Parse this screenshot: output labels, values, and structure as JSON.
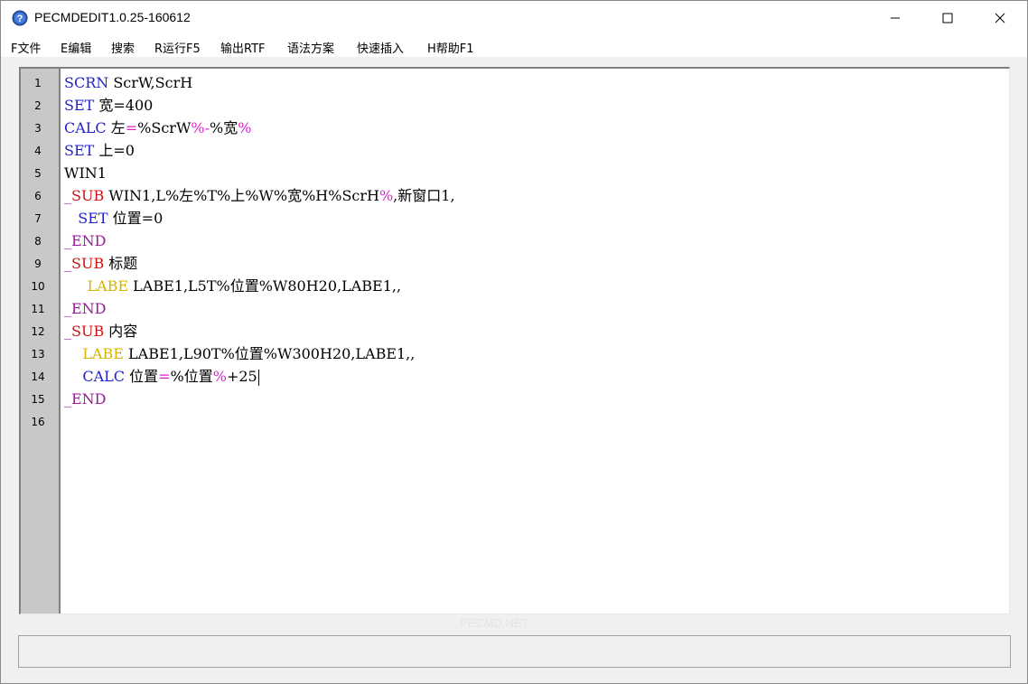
{
  "window": {
    "title": "PECMDEDIT1.0.25-160612",
    "icon": "help-question-icon"
  },
  "menu": [
    {
      "label": "F文件"
    },
    {
      "label": "E编辑"
    },
    {
      "label": "搜索"
    },
    {
      "label": "R运行F5"
    },
    {
      "label": "输出RTF"
    },
    {
      "label": "语法方案"
    },
    {
      "label": "快速插入"
    },
    {
      "label": "H帮助F1"
    }
  ],
  "line_numbers": [
    "1",
    "2",
    "3",
    "4",
    "5",
    "6",
    "7",
    "8",
    "9",
    "10",
    "11",
    "12",
    "13",
    "14",
    "15",
    "16"
  ],
  "code_tokens": {
    "l1": [
      "SCRN",
      " ScrW,ScrH"
    ],
    "l2": [
      "SET",
      " 宽=400"
    ],
    "l3": [
      "CALC",
      " 左",
      "=",
      "%ScrW",
      "%-",
      "%宽",
      "%"
    ],
    "l4": [
      "SET",
      " 上=0"
    ],
    "l5": [
      "WIN1"
    ],
    "l6": [
      "_",
      "SUB",
      " WIN1,L%左%T%上%W%宽%H%ScrH",
      "%",
      ",新窗口1,"
    ],
    "l7": [
      "   ",
      "SET",
      " 位置=0"
    ],
    "l8": [
      "_",
      "END"
    ],
    "l9": [
      "_",
      "SUB",
      " 标题"
    ],
    "l10": [
      "     ",
      "LABE",
      " LABE1,L5T%位置%W80H20,LABE1,,"
    ],
    "l11": [
      "_",
      "END"
    ],
    "l12": [
      "_",
      "SUB",
      " 内容"
    ],
    "l13": [
      "    ",
      "LABE",
      " LABE1,L90T%位置%W300H20,LABE1,,"
    ],
    "l14": [
      "    ",
      "CALC",
      " 位置",
      "=",
      "%位置",
      "%",
      "+25"
    ],
    "l15": [
      "_",
      "END"
    ]
  },
  "watermark": "PECMD.NET",
  "status_text": ""
}
